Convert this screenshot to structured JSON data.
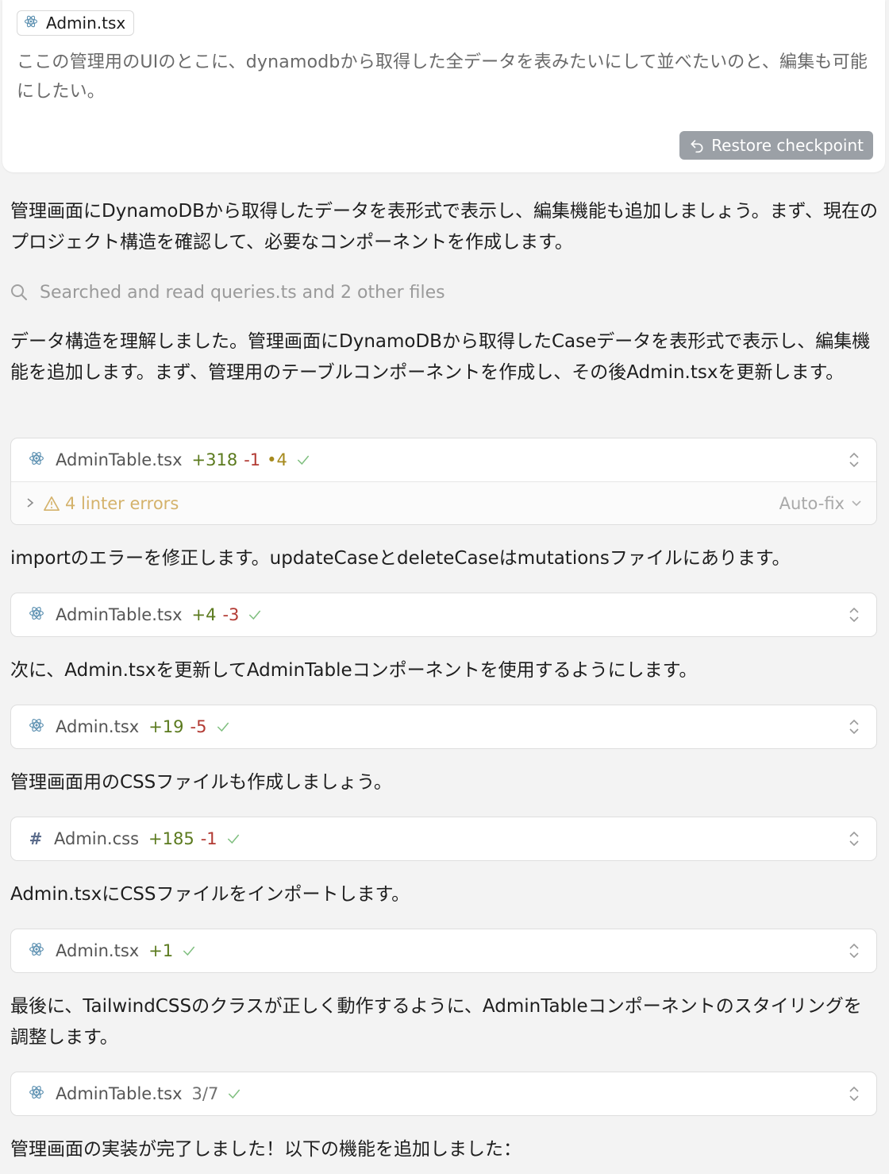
{
  "user_card": {
    "file_chip": "Admin.tsx",
    "message": "ここの管理用のUIのとこに、dynamodbから取得した全データを表みたいにして並べたいのと、編集も可能にしたい。",
    "restore_label": "Restore checkpoint"
  },
  "assistant": {
    "intro": "管理画面にDynamoDBから取得したデータを表形式で表示し、編集機能も追加しましょう。まず、現在のプロジェクト構造を確認して、必要なコンポーネントを作成します。",
    "search_text": "Searched and read queries.ts and 2 other files",
    "p2": "データ構造を理解しました。管理画面にDynamoDBから取得したCaseデータを表形式で表示し、編集機能を追加します。まず、管理用のテーブルコンポーネントを作成し、その後Admin.tsxを更新します。",
    "p3": "importのエラーを修正します。updateCaseとdeleteCaseはmutationsファイルにあります。",
    "p4": "次に、Admin.tsxを更新してAdminTableコンポーネントを使用するようにします。",
    "p5": "管理画面用のCSSファイルも作成しましょう。",
    "p6": "Admin.tsxにCSSファイルをインポートします。",
    "p7": "最後に、TailwindCSSのクラスが正しく動作するように、AdminTableコンポーネントのスタイリングを調整します。",
    "p8": "管理画面の実装が完了しました！以下の機能を追加しました："
  },
  "edits": [
    {
      "file": "AdminTable.tsx",
      "added": "+318",
      "removed": "-1",
      "warn": "•4",
      "icon": "react-icon"
    },
    {
      "file": "AdminTable.tsx",
      "added": "+4",
      "removed": "-3",
      "icon": "react-icon"
    },
    {
      "file": "Admin.tsx",
      "added": "+19",
      "removed": "-5",
      "icon": "react-icon"
    },
    {
      "file": "Admin.css",
      "added": "+185",
      "removed": "-1",
      "icon": "hash-icon",
      "hash": "#"
    },
    {
      "file": "Admin.tsx",
      "added": "+1",
      "icon": "react-icon"
    },
    {
      "file": "AdminTable.tsx",
      "progress": "3/7",
      "icon": "react-icon"
    }
  ],
  "lint": {
    "text": "4 linter errors",
    "autofix": "Auto-fix"
  },
  "colors": {
    "added": "#5b7a1e",
    "removed": "#b23a33",
    "warn": "#d4b26b",
    "check": "#7fbf7f"
  }
}
